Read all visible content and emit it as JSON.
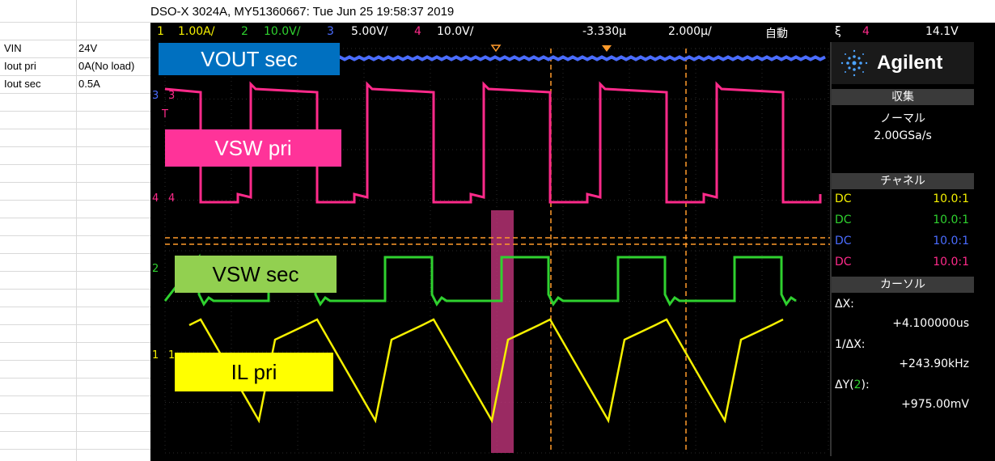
{
  "spreadsheet": {
    "rows": [
      {
        "label": "VIN",
        "value": "24V"
      },
      {
        "label": "Iout pri",
        "value": "0A(No load)"
      },
      {
        "label": "Iout sec",
        "value": "0.5A"
      }
    ]
  },
  "scope": {
    "title": "DSO-X 3024A, MY51360667: Tue Jun 25 19:58:37 2019",
    "status": {
      "ch1_num": "1",
      "ch1_scale": "1.00A/",
      "ch2_num": "2",
      "ch2_scale": "10.0V/",
      "ch3_num": "3",
      "ch3_scale": "5.00V/",
      "ch4_num": "4",
      "ch4_scale": "10.0V/",
      "time_offset": "-3.330µ",
      "time_scale": "2.000µ/",
      "trigger_mode": "自動",
      "trigger_symbol": "ξ",
      "trigger_ch": "4",
      "trigger_level": "14.1V"
    },
    "colors": {
      "ch1": "#f5f000",
      "ch2": "#2fd12f",
      "ch3": "#4a6cff",
      "ch4": "#ff2a8a",
      "cursor": "#ff9a2a"
    },
    "labels": {
      "vout": "VOUT sec",
      "vsw_pri": "VSW pri",
      "vsw_sec": "VSW sec",
      "il_pri": "IL pri"
    },
    "markers": {
      "ch3": "3",
      "ch4": "4",
      "ch2": "2",
      "ch1": "1",
      "trig": "T"
    },
    "panel": {
      "brand": "Agilent",
      "acq_header": "収集",
      "acq_mode": "ノーマル",
      "acq_rate": "2.00GSa/s",
      "ch_header": "チャネル",
      "channels": [
        {
          "coupling": "DC",
          "probe": "10.0:1"
        },
        {
          "coupling": "DC",
          "probe": "10.0:1"
        },
        {
          "coupling": "DC",
          "probe": "10.0:1"
        },
        {
          "coupling": "DC",
          "probe": "10.0:1"
        }
      ],
      "cursor_header": "カーソル",
      "dx_label": "ΔX:",
      "dx_value": "+4.100000us",
      "inv_dx_label": "1/ΔX:",
      "inv_dx_value": "+243.90kHz",
      "dy_label_pre": "ΔY(",
      "dy_label_ch": "2",
      "dy_label_post": "):",
      "dy_value": "+975.00mV"
    }
  }
}
